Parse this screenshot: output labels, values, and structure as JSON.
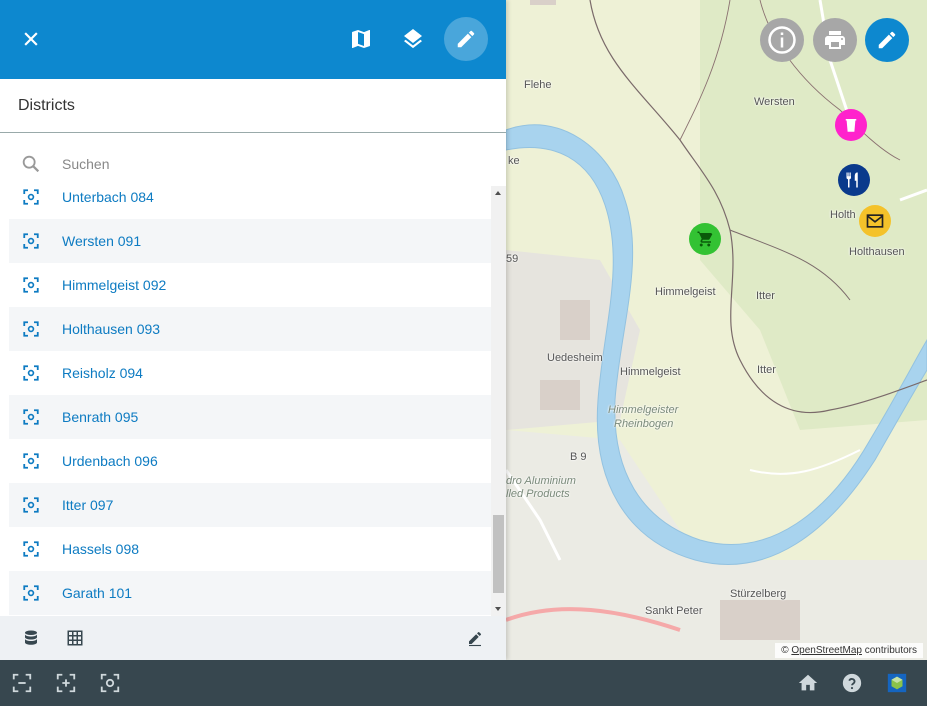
{
  "colors": {
    "primary": "#0d88cf",
    "link": "#0d7bc2",
    "bottombar": "#37474f",
    "poi_shop": "#33c233",
    "poi_trash": "#ff22cc",
    "poi_food": "#0a3a8c",
    "poi_mail": "#f4c22a"
  },
  "header": {
    "icons": [
      "close-icon",
      "map-icon",
      "layers-icon",
      "edit-icon"
    ]
  },
  "panel": {
    "title": "Districts",
    "search": {
      "placeholder": "Suchen",
      "value": ""
    },
    "items": [
      {
        "label": "Unterbach 084"
      },
      {
        "label": "Wersten 091"
      },
      {
        "label": "Himmelgeist 092"
      },
      {
        "label": "Holthausen 093"
      },
      {
        "label": "Reisholz 094"
      },
      {
        "label": "Benrath 095"
      },
      {
        "label": "Urdenbach 096"
      },
      {
        "label": "Itter 097"
      },
      {
        "label": "Hassels 098"
      },
      {
        "label": "Garath 101"
      }
    ],
    "footer_icons": [
      "database-icon",
      "table-icon",
      "edit-note-icon"
    ]
  },
  "map": {
    "labels": {
      "flehe": "Flehe",
      "wersten_top": "Wersten",
      "holthausen": "Holthausen",
      "holth_partial": "Holth",
      "himmelgeist_upper": "Himmelgeist",
      "itter_upper": "Itter",
      "uedesheim": "Uedesheim",
      "himmelgeist": "Himmelgeist",
      "itter": "Itter",
      "himmelgeister_rheinbogen_1": "Himmelgeister",
      "himmelgeister_rheinbogen_2": "Rheinbogen",
      "b9": "B 9",
      "aluminium_1": "dro Aluminium",
      "aluminium_2": "lled Products",
      "sankt_peter": "Sankt Peter",
      "sturzelberg": "Stürzelberg",
      "ke": "ke",
      "s59": "59"
    },
    "buttons": [
      "info-icon",
      "print-icon",
      "edit-icon"
    ],
    "attribution": {
      "prefix": "©",
      "link": "OpenStreetMap",
      "suffix": "contributors"
    }
  },
  "bottombar": {
    "left_icons": [
      "zoom-extent-icon",
      "zoom-in-area-icon",
      "zoom-to-feature-icon"
    ],
    "right_icons": [
      "home-icon",
      "help-icon",
      "logo-cube-icon"
    ]
  }
}
